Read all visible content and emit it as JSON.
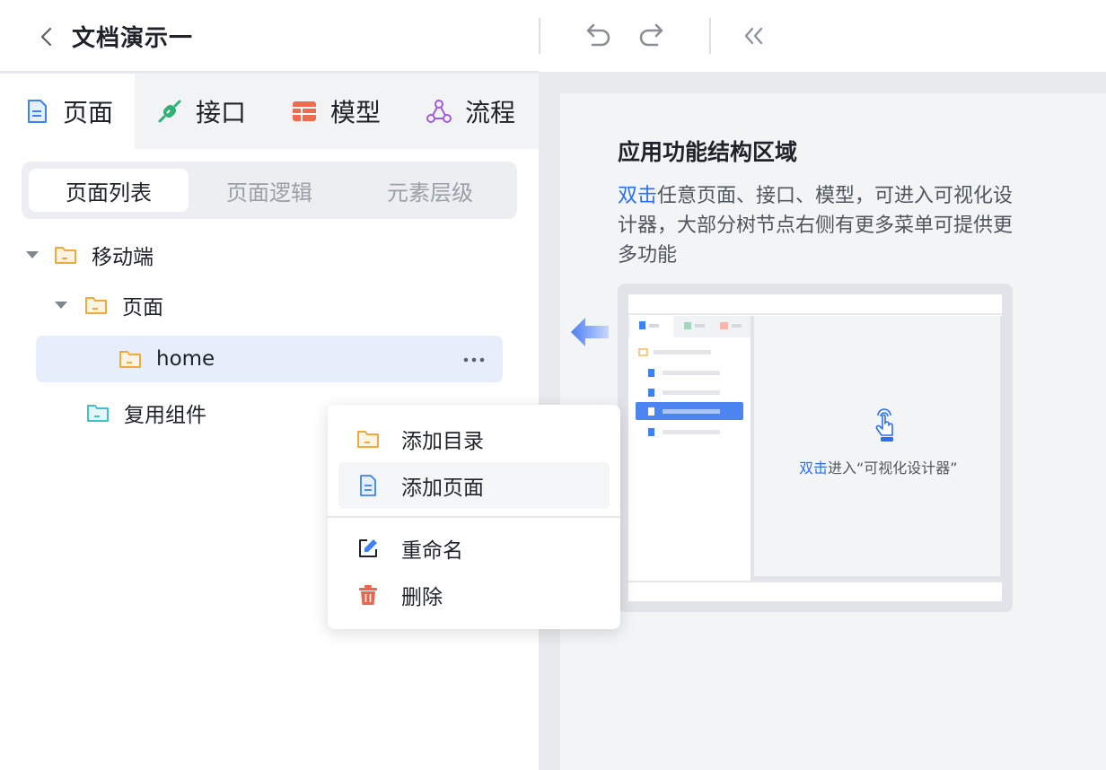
{
  "header": {
    "title": "文档演示一"
  },
  "main_tabs": [
    {
      "label": "页面",
      "icon": "page-icon",
      "color": "#3b82f6"
    },
    {
      "label": "接口",
      "icon": "plug-icon",
      "color": "#22a06b"
    },
    {
      "label": "模型",
      "icon": "table-icon",
      "color": "#ee6c4d"
    },
    {
      "label": "流程",
      "icon": "flow-icon",
      "color": "#a05ae0"
    }
  ],
  "sub_tabs": [
    {
      "label": "页面列表"
    },
    {
      "label": "页面逻辑"
    },
    {
      "label": "元素层级"
    }
  ],
  "tree": [
    {
      "label": "移动端"
    },
    {
      "label": "页面"
    },
    {
      "label": "home"
    },
    {
      "label": "复用组件"
    }
  ],
  "context_menu": [
    {
      "label": "添加目录",
      "icon": "folder-add-icon"
    },
    {
      "label": "添加页面",
      "icon": "page-add-icon"
    },
    {
      "label": "重命名",
      "icon": "edit-icon"
    },
    {
      "label": "删除",
      "icon": "trash-icon"
    }
  ],
  "help": {
    "title": "应用功能结构区域",
    "desc_highlight": "双击",
    "desc_rest": "任意页面、接口、模型，可进入可视化设计器，大部分树节点右侧有更多菜单可提供更多功能",
    "caption_highlight": "双击",
    "caption_rest": "进入“可视化设计器”"
  },
  "colors": {
    "accent": "#2b6ff0",
    "folder": "#f2a93b",
    "folder_teal": "#3ec1c9",
    "selected_bg": "#e7eefb",
    "delete": "#e8674c"
  }
}
